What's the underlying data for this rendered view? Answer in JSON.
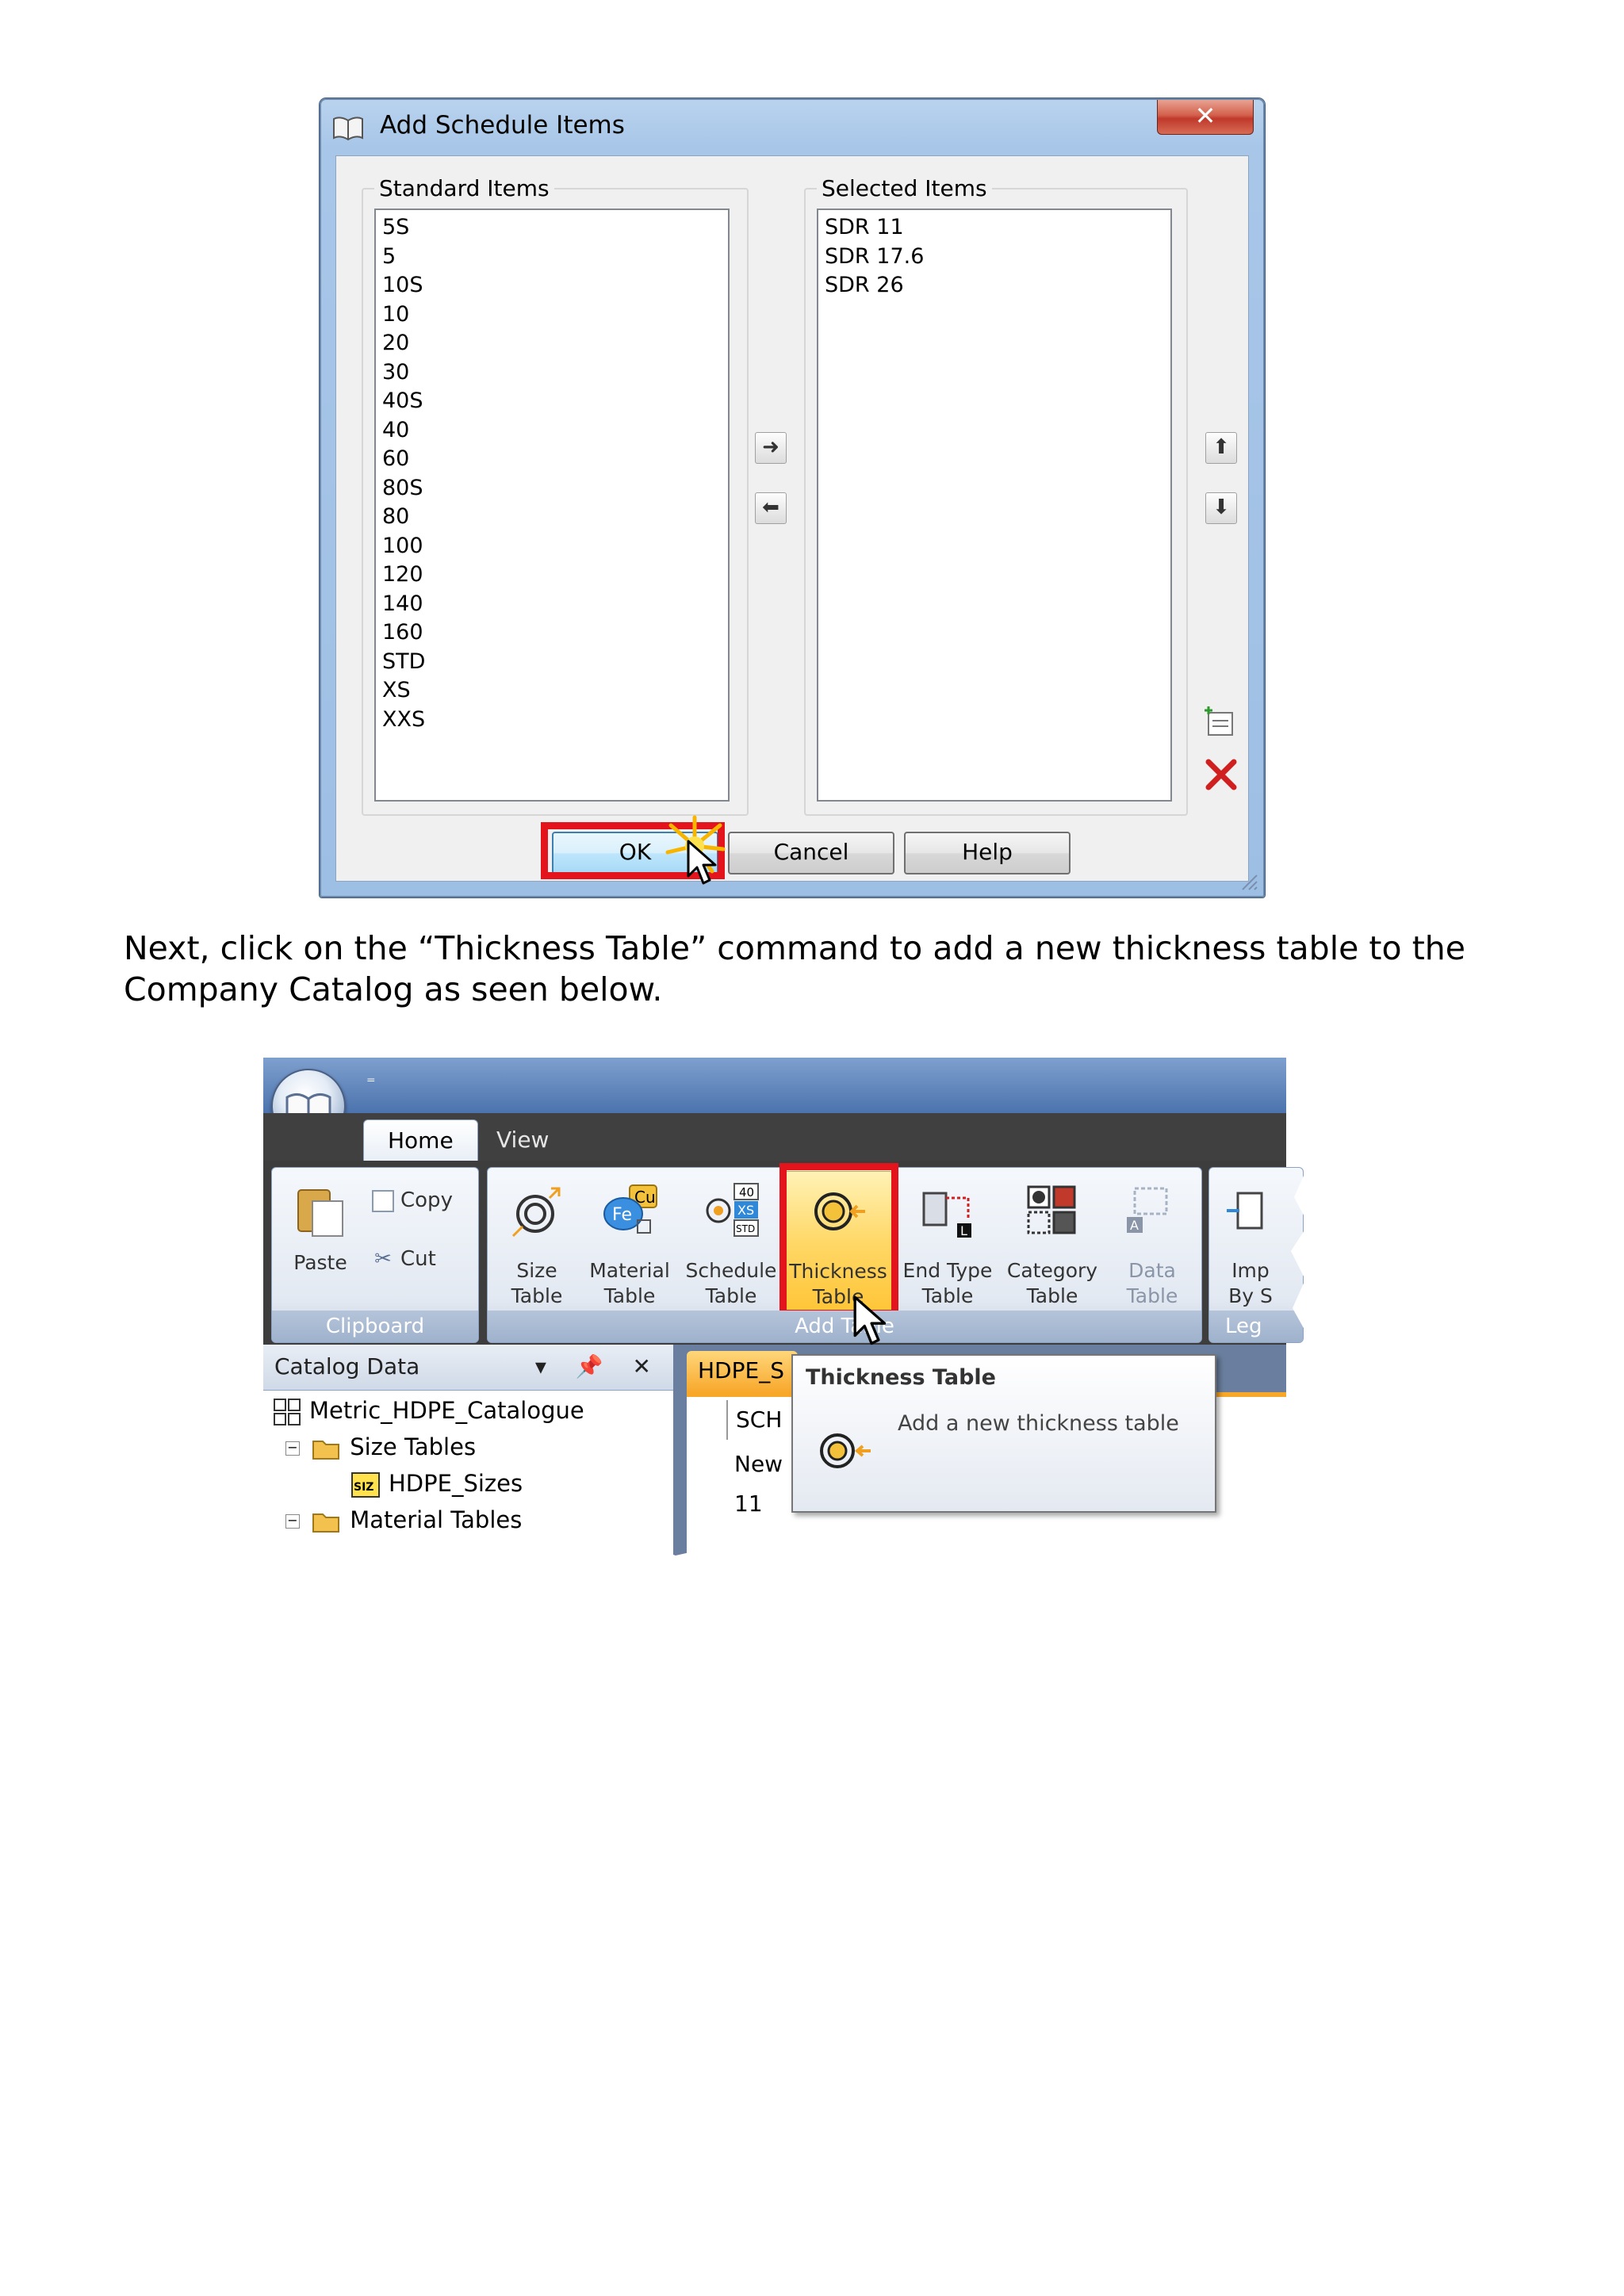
{
  "dialog": {
    "title": "Add Schedule Items",
    "close_glyph": "✕",
    "standard_label": "Standard Items",
    "selected_label": "Selected Items",
    "standard_items": [
      "5S",
      "5",
      "10S",
      "10",
      "20",
      "30",
      "40S",
      "40",
      "60",
      "80S",
      "80",
      "100",
      "120",
      "140",
      "160",
      "STD",
      "XS",
      "XXS"
    ],
    "selected_items": [
      "SDR 11",
      "SDR 17.6",
      "SDR 26"
    ],
    "buttons": {
      "ok": "OK",
      "cancel": "Cancel",
      "help": "Help"
    },
    "arrows": {
      "add": "➜",
      "remove": "⬅",
      "up": "⬆",
      "down": "⬇"
    }
  },
  "paragraph": "Next, click on the “Thickness Table” command to add a new thickness table to the Company Catalog as seen below.",
  "app": {
    "qat_glyph": "⁼",
    "tabs": [
      "Home",
      "View"
    ],
    "clipboard": {
      "paste": "Paste",
      "copy": "Copy",
      "cut": "Cut",
      "caption": "Clipboard"
    },
    "add_table_group": {
      "caption": "Add Table",
      "buttons": [
        {
          "line1": "Size",
          "line2": "Table"
        },
        {
          "line1": "Material",
          "line2": "Table"
        },
        {
          "line1": "Schedule",
          "line2": "Table"
        },
        {
          "line1": "Thickness",
          "line2": "Table"
        },
        {
          "line1": "End Type",
          "line2": "Table"
        },
        {
          "line1": "Category",
          "line2": "Table"
        },
        {
          "line1": "Data",
          "line2": "Table"
        }
      ]
    },
    "import_group": {
      "line1": "Imp",
      "line2": "By S",
      "caption": "Leg"
    },
    "icon_text": {
      "cu": "Cu",
      "fe": "Fe",
      "n40": "40",
      "xs": "XS",
      "std": "STD",
      "l": "L",
      "a": "A",
      "siz": "SIZ"
    },
    "pane": {
      "title": "Catalog Data",
      "tools": "▾ 📌 ✕",
      "tree": [
        "Metric_HDPE_Catalogue",
        "Size Tables",
        "HDPE_Sizes",
        "Material Tables"
      ]
    },
    "doc_tab": "HDPE_S",
    "grid": {
      "header": "SCH",
      "row1": "New",
      "row2": "11"
    },
    "tooltip": {
      "title": "Thickness Table",
      "description": "Add a new thickness table"
    }
  }
}
